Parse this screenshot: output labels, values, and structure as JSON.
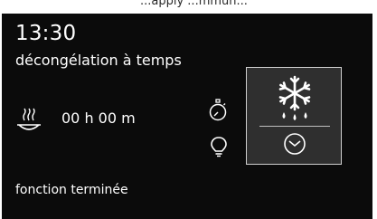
{
  "top_fragment": "...apply ...mmun...",
  "display": {
    "time": "13:30",
    "mode_label": "décongélation à temps",
    "duration": "00 h 00 m",
    "status_text": "fonction terminée"
  },
  "icons": {
    "steam": "steam-dish-icon",
    "timer": "stopwatch-icon",
    "lamp": "light-bulb-icon",
    "function": "snowflake-defrost-icon",
    "clock": "clock-icon"
  },
  "colors": {
    "screen_bg": "#0b0b0b",
    "panel_bg": "#2f2f2f",
    "text": "#ffffff"
  }
}
